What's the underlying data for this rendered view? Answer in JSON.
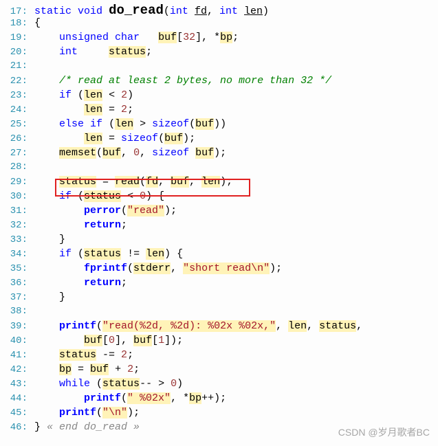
{
  "gutter_start": 17,
  "watermark": "CSDN @岁月歌者BC",
  "tokens": {
    "static": "static",
    "void": "void",
    "int": "int",
    "unsigned": "unsigned",
    "char": "char",
    "if": "if",
    "else": "else",
    "return": "return",
    "while": "while",
    "sizeof": "sizeof",
    "do_read": "do_read",
    "fd": "fd",
    "len": "len",
    "buf": "buf",
    "bp": "bp",
    "status": "status",
    "memset": "memset",
    "read": "read",
    "perror": "perror",
    "fprintf": "fprintf",
    "stderr": "stderr",
    "printf": "printf",
    "n32": "32",
    "n2": "2",
    "n0": "0",
    "n1": "1",
    "comment_header": "/* read at least 2 bytes, no more than 32 */",
    "str_read": "\"read\"",
    "str_short": "\"short read\\n\"",
    "str_fmt_open": "\"read(%2d, %2d): %02x %02x,\"",
    "str_fmt_hex": "\" %02x\"",
    "str_nl": "\"\\n\"",
    "end_comment": "« end do_read »"
  }
}
